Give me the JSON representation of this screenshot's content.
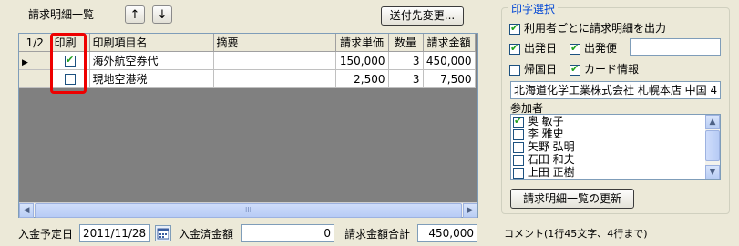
{
  "header": {
    "title": "請求明細一覧",
    "up_label": "↑",
    "down_label": "↓",
    "send_dest_label": "送付先変更..."
  },
  "grid": {
    "page": "1/2",
    "columns": [
      "印刷",
      "印刷項目名",
      "摘要",
      "請求単価",
      "数量",
      "請求金額"
    ],
    "rows": [
      {
        "current": true,
        "print": true,
        "name": "海外航空券代",
        "note": "",
        "unit_price": "150,000",
        "qty": "3",
        "amount": "450,000"
      },
      {
        "current": false,
        "print": false,
        "name": "現地空港税",
        "note": "",
        "unit_price": "2,500",
        "qty": "3",
        "amount": "7,500"
      }
    ],
    "scroll_thumb": "III"
  },
  "footer": {
    "due_date_label": "入金予定日",
    "due_date_value": "2011/11/28",
    "paid_label": "入金済金額",
    "paid_value": "0",
    "total_label": "請求金額合計",
    "total_value": "450,000"
  },
  "print_options": {
    "legend": "印字選択",
    "per_user": {
      "label": "利用者ごとに請求明細を出力",
      "checked": true
    },
    "departure_date": {
      "label": "出発日",
      "checked": true
    },
    "departure_flight": {
      "label": "出発便",
      "checked": true
    },
    "flight_value": "",
    "return_date": {
      "label": "帰国日",
      "checked": false
    },
    "card_info": {
      "label": "カード情報",
      "checked": true
    },
    "company": "北海道化学工業株式会社 札幌本店 中国 4",
    "participants_label": "参加者",
    "participants": [
      {
        "name": "奥 敏子",
        "checked": true
      },
      {
        "name": "李 雅史",
        "checked": false
      },
      {
        "name": "矢野 弘明",
        "checked": false
      },
      {
        "name": "石田 和夫",
        "checked": false
      },
      {
        "name": "上田 正樹",
        "checked": false
      }
    ],
    "refresh_label": "請求明細一覧の更新",
    "comment_label": "コメント(1行45文字、4行まで)"
  }
}
